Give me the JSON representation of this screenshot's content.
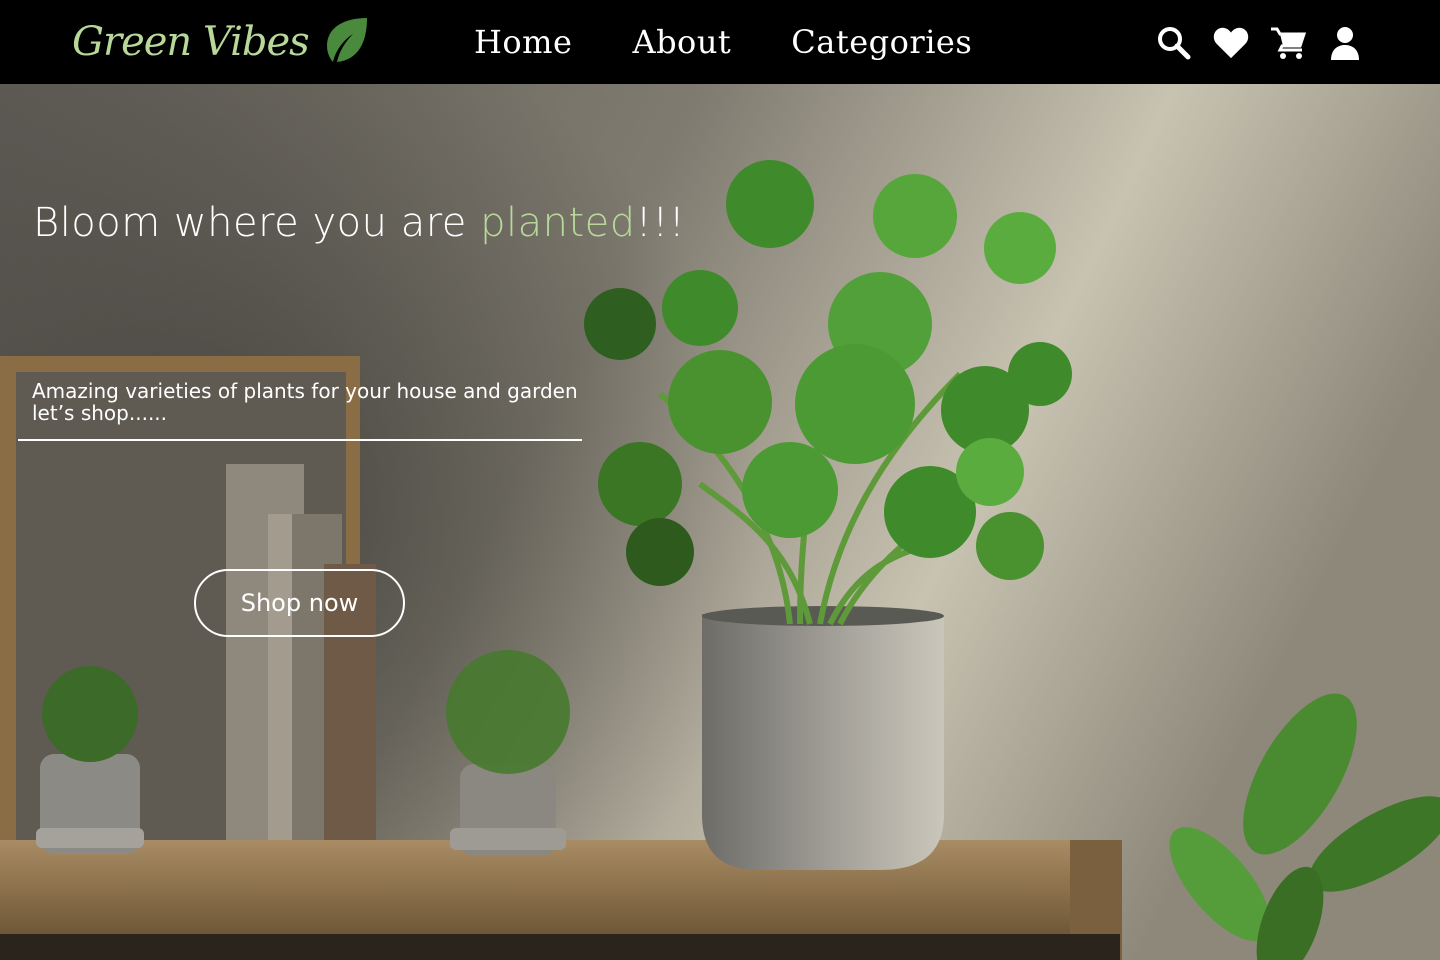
{
  "brand": {
    "name": "Green Vibes",
    "accent_color": "#b8d89a",
    "leaf_color": "#4a8a3c"
  },
  "nav": {
    "links": [
      {
        "label": "Home"
      },
      {
        "label": "About"
      },
      {
        "label": "Categories"
      }
    ],
    "icons": [
      "search-icon",
      "heart-icon",
      "cart-icon",
      "user-icon"
    ]
  },
  "hero": {
    "headline_prefix": "Bloom where you are ",
    "headline_accent": "planted",
    "headline_suffix": "!!!",
    "tagline_line1": "Amazing varieties of plants for your house and garden",
    "tagline_line2": "let’s shop......",
    "cta_label": "Shop now"
  }
}
